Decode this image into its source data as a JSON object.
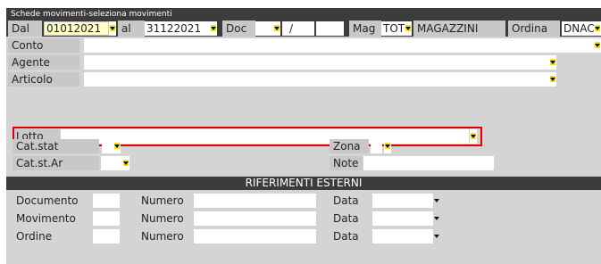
{
  "window": {
    "title": "Schede movimenti-seleziona movimenti"
  },
  "header_row": {
    "dal_label": "Dal",
    "dal_value": "01012021",
    "al_label": "al",
    "al_value": "31122021",
    "doc_label": "Doc",
    "doc_separator": "/",
    "mag_label": "Mag",
    "mag_value": "TOT",
    "mag_description": "MAGAZZINI",
    "ordina_label": "Ordina",
    "ordina_value": "DNAC"
  },
  "fields": {
    "conto_label": "Conto",
    "agente_label": "Agente",
    "articolo_label": "Articolo",
    "lotto_label": "Lotto",
    "catstat_label": "Cat.stat",
    "catstar_label": "Cat.st.Ar",
    "zona_label": "Zona",
    "note_label": "Note"
  },
  "riferimenti": {
    "title": "RIFERIMENTI ESTERNI",
    "rows": [
      {
        "label": "Documento",
        "numero_label": "Numero",
        "data_label": "Data"
      },
      {
        "label": "Movimento",
        "numero_label": "Numero",
        "data_label": "Data"
      },
      {
        "label": "Ordine",
        "numero_label": "Numero",
        "data_label": "Data"
      }
    ]
  },
  "colors": {
    "title_bar": "#3c3c3c",
    "background": "#d4d4d4",
    "highlight_border": "#e00000",
    "dropdown_accent": "#f5df1f",
    "active_field": "#ffffcc"
  },
  "icons": [
    "dropdown-arrow-icon"
  ]
}
